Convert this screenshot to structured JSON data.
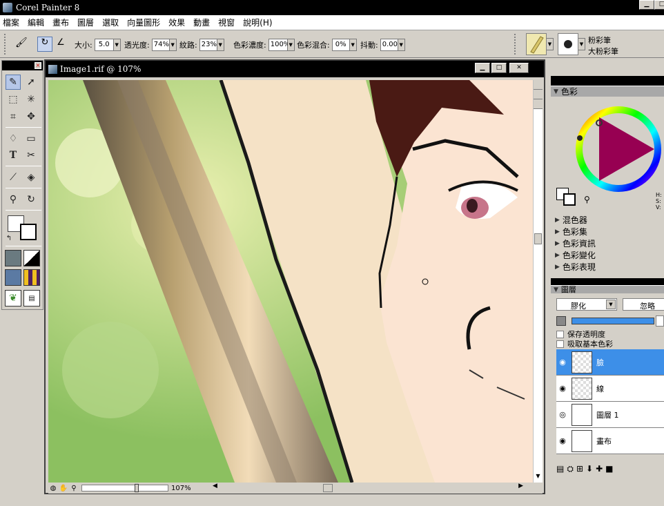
{
  "app": {
    "title": "Corel Painter 8"
  },
  "menu": [
    "檔案",
    "編輯",
    "畫布",
    "圖層",
    "選取",
    "向量圖形",
    "效果",
    "動畫",
    "視窗",
    "說明(H)"
  ],
  "props": {
    "size_label": "大小:",
    "size_value": "5.0",
    "opacity_label": "透光度:",
    "opacity_value": "74%",
    "grain_label": "紋路:",
    "grain_value": "23%",
    "resaturation_label": "色彩濃度:",
    "resaturation_value": "100%",
    "bleed_label": "色彩混合:",
    "bleed_value": "0%",
    "jitter_label": "抖動:",
    "jitter_value": "0.00",
    "brush_category": "粉彩筆",
    "brush_variant": "大粉彩筆"
  },
  "document": {
    "title": "Image1.rif @ 107%",
    "zoom": "107%"
  },
  "panels": {
    "color_title": "色彩",
    "sections": [
      "混色器",
      "色彩集",
      "色彩資訊",
      "色彩變化",
      "色彩表現"
    ],
    "layers_title": "圖層",
    "composite_method": "膠化",
    "ignore_label": "忽略",
    "preserve_transparency": "保存透明度",
    "pick_up_color": "吸取基本色彩",
    "hsv_labels": [
      "H:",
      "S:",
      "V:"
    ],
    "layers": [
      {
        "name": "臉",
        "selected": true
      },
      {
        "name": "線",
        "selected": false
      },
      {
        "name": "圖層 1",
        "selected": false
      },
      {
        "name": "畫布",
        "selected": false
      }
    ]
  },
  "colors": {
    "selection": "#3d8fe8",
    "accent_red": "#e8007f"
  }
}
